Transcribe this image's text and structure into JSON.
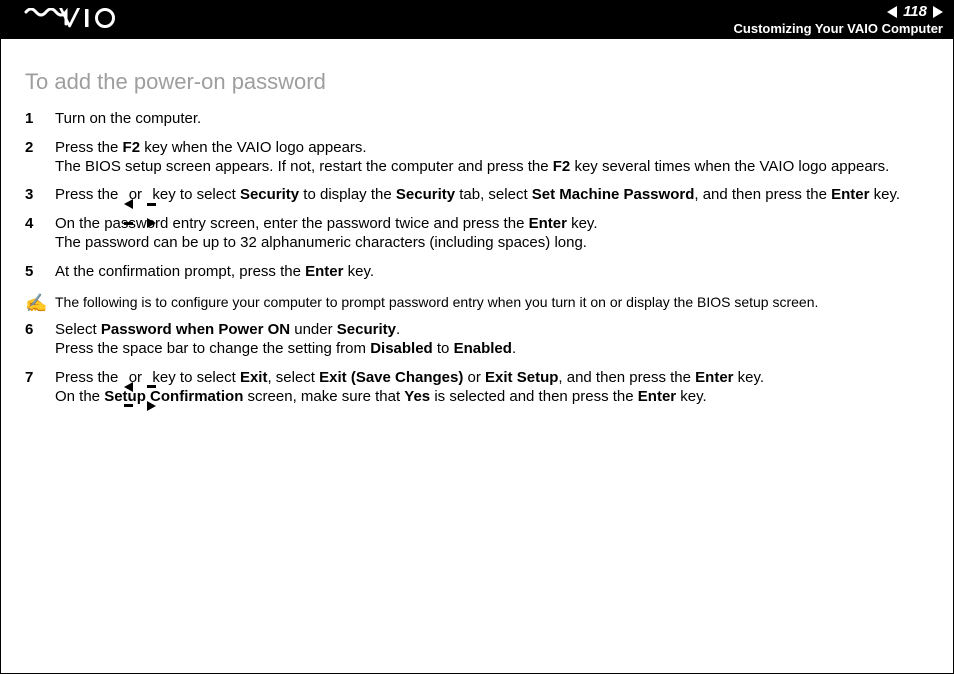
{
  "header": {
    "page_number": "118",
    "section": "Customizing Your VAIO Computer"
  },
  "heading": "To add the power-on password",
  "steps": [
    {
      "n": "1",
      "plain": "Turn on the computer."
    },
    {
      "n": "2",
      "parts": [
        "Press the ",
        {
          "b": "F2"
        },
        " key when the VAIO logo appears.\nThe BIOS setup screen appears. If not, restart the computer and press the ",
        {
          "b": "F2"
        },
        " key several times when the VAIO logo appears."
      ]
    },
    {
      "n": "3",
      "parts": [
        "Press the ",
        {
          "arrow": "left"
        },
        " or ",
        {
          "arrow": "right"
        },
        " key to select ",
        {
          "b": "Security"
        },
        " to display the ",
        {
          "b": "Security"
        },
        " tab, select ",
        {
          "b": "Set Machine Password"
        },
        ", and then press the ",
        {
          "b": "Enter"
        },
        " key."
      ]
    },
    {
      "n": "4",
      "parts": [
        "On the password entry screen, enter the password twice and press the ",
        {
          "b": "Enter"
        },
        " key.\nThe password can be up to 32 alphanumeric characters (including spaces) long."
      ]
    },
    {
      "n": "5",
      "parts": [
        "At the confirmation prompt, press the ",
        {
          "b": "Enter"
        },
        " key."
      ]
    }
  ],
  "note": "The following is to configure your computer to prompt password entry when you turn it on or display the BIOS setup screen.",
  "steps2": [
    {
      "n": "6",
      "parts": [
        "Select ",
        {
          "b": "Password when Power ON"
        },
        " under ",
        {
          "b": "Security"
        },
        ".\nPress the space bar to change the setting from ",
        {
          "b": "Disabled"
        },
        " to ",
        {
          "b": "Enabled"
        },
        "."
      ]
    },
    {
      "n": "7",
      "parts": [
        "Press the ",
        {
          "arrow": "left"
        },
        " or ",
        {
          "arrow": "right"
        },
        " key to select ",
        {
          "b": "Exit"
        },
        ", select ",
        {
          "b": "Exit (Save Changes)"
        },
        " or ",
        {
          "b": "Exit Setup"
        },
        ", and then press the ",
        {
          "b": "Enter"
        },
        " key.\nOn the ",
        {
          "b": "Setup Confirmation"
        },
        " screen, make sure that ",
        {
          "b": "Yes"
        },
        " is selected and then press the ",
        {
          "b": "Enter"
        },
        " key."
      ]
    }
  ]
}
